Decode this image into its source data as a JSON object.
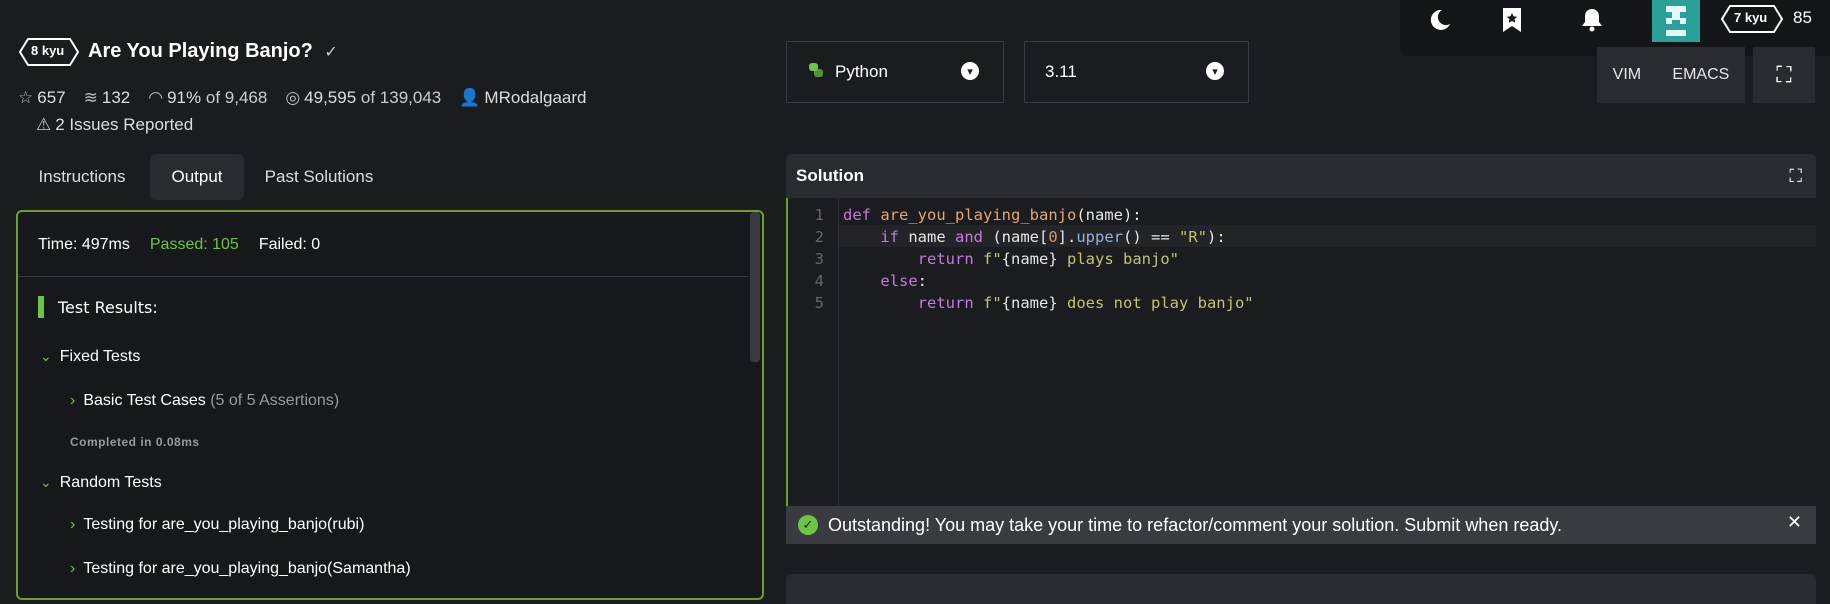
{
  "topbar": {
    "icons": [
      "moon-icon",
      "bookmark-star-icon",
      "bell-icon"
    ],
    "user_rank": "7 kyu",
    "honor": "85"
  },
  "kata": {
    "rank": "8 kyu",
    "title": "Are You Playing Banjo?",
    "stats": {
      "stars": "657",
      "collections": "132",
      "satisfaction_pct": "91%",
      "satisfaction_of": "of 9,468",
      "completed": "49,595",
      "attempted": "of 139,043",
      "author": "MRodalgaard"
    },
    "issues": "2 Issues Reported"
  },
  "language": {
    "selected": "Python"
  },
  "version": {
    "selected": "3.11"
  },
  "editor_modes": {
    "vim": "VIM",
    "emacs": "EMACS"
  },
  "tabs": [
    {
      "label": "Instructions"
    },
    {
      "label": "Output"
    },
    {
      "label": "Past Solutions"
    }
  ],
  "output": {
    "time": "Time: 497ms",
    "passed": "Passed: 105",
    "failed": "Failed: 0",
    "results_label": "Test Results:",
    "groups": [
      {
        "name": "Fixed Tests",
        "items": [
          {
            "name": "Basic Test Cases",
            "detail": "(5 of 5 Assertions)"
          }
        ],
        "completed": "Completed in 0.08ms"
      },
      {
        "name": "Random Tests",
        "items": [
          {
            "name": "Testing for are_you_playing_banjo(rubi)",
            "detail": ""
          },
          {
            "name": "Testing for are_you_playing_banjo(Samantha)",
            "detail": ""
          }
        ]
      }
    ]
  },
  "solution": {
    "title": "Solution",
    "line_numbers": [
      "1",
      "2",
      "3",
      "4",
      "5"
    ]
  },
  "banner": {
    "message": "Outstanding! You may take your time to refactor/comment your solution. Submit when ready."
  },
  "colors": {
    "accent_green": "#6cc644",
    "panel_border": "#6d9e2f",
    "background": "#1b1c20"
  }
}
